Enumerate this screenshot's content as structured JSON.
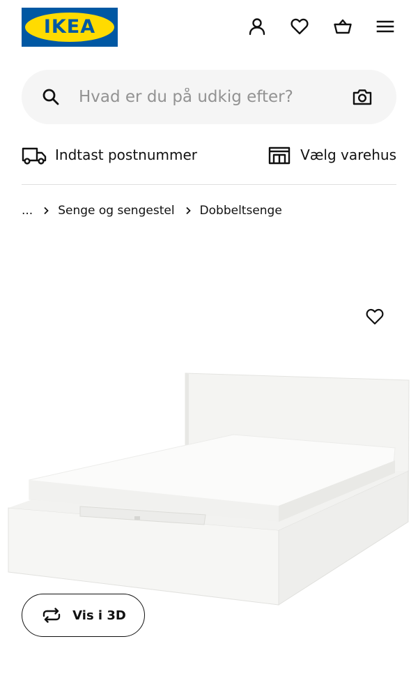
{
  "header": {
    "logo_text": "IKEA",
    "icons": [
      "user-icon",
      "heart-icon",
      "basket-icon",
      "menu-icon"
    ]
  },
  "search": {
    "placeholder": "Hvad er du på udkig efter?",
    "value": ""
  },
  "delivery": {
    "postcode_label": "Indtast postnummer",
    "store_label": "Vælg varehus"
  },
  "breadcrumb": {
    "ellipsis": "...",
    "items": [
      "Senge og sengestel",
      "Dobbeltsenge"
    ]
  },
  "product": {
    "image_icon": "bed-image",
    "favorite_icon": "heart-icon",
    "view_3d_label": "Vis i 3D"
  },
  "colors": {
    "brand_blue": "#0058a3",
    "brand_yellow": "#ffdb00",
    "search_bg": "#f5f5f5",
    "text": "#111111",
    "placeholder": "#929292"
  }
}
